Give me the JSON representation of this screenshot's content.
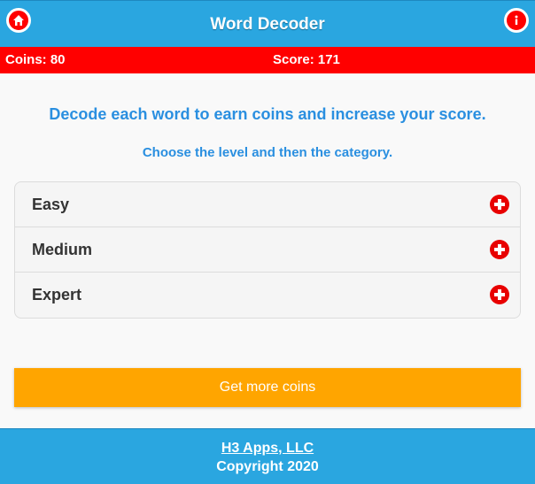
{
  "header": {
    "title": "Word Decoder",
    "home_icon": "home-icon",
    "info_icon": "info-icon"
  },
  "status": {
    "coins": "Coins: 80",
    "score": "Score: 171"
  },
  "intro": {
    "headline": "Decode each word to earn coins and increase your score.",
    "instruction": "Choose the level and then the category."
  },
  "levels": [
    {
      "label": "Easy",
      "icon": "plus-icon"
    },
    {
      "label": "Medium",
      "icon": "plus-icon"
    },
    {
      "label": "Expert",
      "icon": "plus-icon"
    }
  ],
  "actions": {
    "get_coins": "Get more coins"
  },
  "footer": {
    "company": "H3 Apps, LLC",
    "copyright": "Copyright 2020"
  },
  "colors": {
    "header_bg": "#2aa6e0",
    "status_bg": "#ff0000",
    "accent_text": "#2a8fe0",
    "button_bg": "#ffa500",
    "icon_red": "#e80000"
  }
}
